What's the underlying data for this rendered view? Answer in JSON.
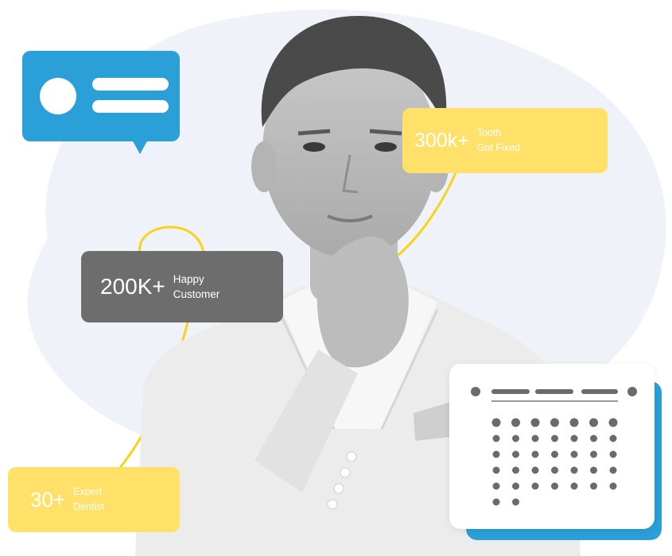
{
  "colors": {
    "blob": "#eff3f9",
    "accent_blue": "#2b9fd8",
    "accent_yellow": "#ffe169",
    "card_gray": "#6d6d6d",
    "curve_yellow": "#f7d31a",
    "calendar_dot": "#6b6b6b"
  },
  "stats": {
    "tooth": {
      "number": "300k+",
      "label_line1": "Tooth",
      "label_line2": "Got Fixed"
    },
    "customer": {
      "number": "200K+",
      "label_line1": "Happy",
      "label_line2": "Customer"
    },
    "dentist": {
      "number": "30+",
      "label_line1": "Expert",
      "label_line2": "Dentist"
    }
  },
  "icons": {
    "chat": "chat-bubble-icon",
    "calendar": "calendar-icon"
  },
  "calendar": {
    "dot_rows": [
      7,
      7,
      7,
      7,
      7,
      2
    ]
  }
}
